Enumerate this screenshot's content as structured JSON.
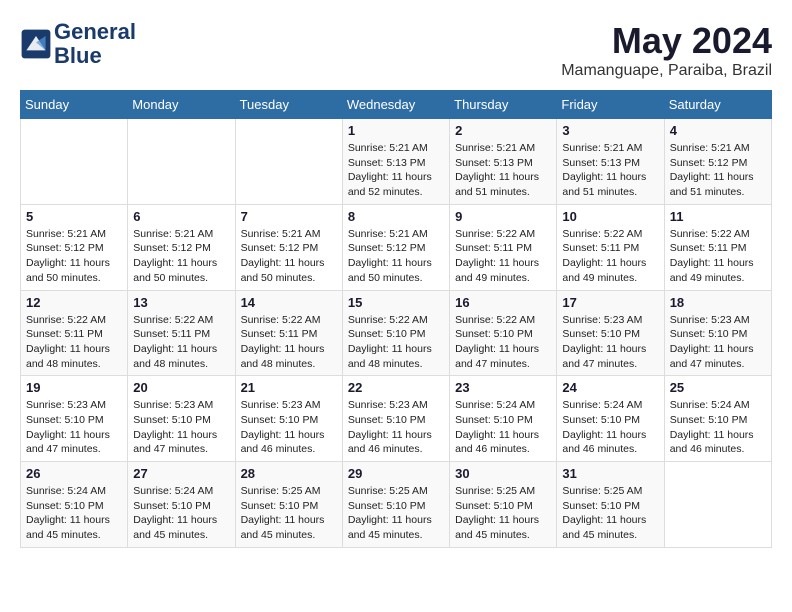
{
  "logo": {
    "line1": "General",
    "line2": "Blue"
  },
  "title": "May 2024",
  "subtitle": "Mamanguape, Paraiba, Brazil",
  "weekdays": [
    "Sunday",
    "Monday",
    "Tuesday",
    "Wednesday",
    "Thursday",
    "Friday",
    "Saturday"
  ],
  "weeks": [
    [
      {
        "day": "",
        "sunrise": "",
        "sunset": "",
        "daylight": ""
      },
      {
        "day": "",
        "sunrise": "",
        "sunset": "",
        "daylight": ""
      },
      {
        "day": "",
        "sunrise": "",
        "sunset": "",
        "daylight": ""
      },
      {
        "day": "1",
        "sunrise": "Sunrise: 5:21 AM",
        "sunset": "Sunset: 5:13 PM",
        "daylight": "Daylight: 11 hours and 52 minutes."
      },
      {
        "day": "2",
        "sunrise": "Sunrise: 5:21 AM",
        "sunset": "Sunset: 5:13 PM",
        "daylight": "Daylight: 11 hours and 51 minutes."
      },
      {
        "day": "3",
        "sunrise": "Sunrise: 5:21 AM",
        "sunset": "Sunset: 5:13 PM",
        "daylight": "Daylight: 11 hours and 51 minutes."
      },
      {
        "day": "4",
        "sunrise": "Sunrise: 5:21 AM",
        "sunset": "Sunset: 5:12 PM",
        "daylight": "Daylight: 11 hours and 51 minutes."
      }
    ],
    [
      {
        "day": "5",
        "sunrise": "Sunrise: 5:21 AM",
        "sunset": "Sunset: 5:12 PM",
        "daylight": "Daylight: 11 hours and 50 minutes."
      },
      {
        "day": "6",
        "sunrise": "Sunrise: 5:21 AM",
        "sunset": "Sunset: 5:12 PM",
        "daylight": "Daylight: 11 hours and 50 minutes."
      },
      {
        "day": "7",
        "sunrise": "Sunrise: 5:21 AM",
        "sunset": "Sunset: 5:12 PM",
        "daylight": "Daylight: 11 hours and 50 minutes."
      },
      {
        "day": "8",
        "sunrise": "Sunrise: 5:21 AM",
        "sunset": "Sunset: 5:12 PM",
        "daylight": "Daylight: 11 hours and 50 minutes."
      },
      {
        "day": "9",
        "sunrise": "Sunrise: 5:22 AM",
        "sunset": "Sunset: 5:11 PM",
        "daylight": "Daylight: 11 hours and 49 minutes."
      },
      {
        "day": "10",
        "sunrise": "Sunrise: 5:22 AM",
        "sunset": "Sunset: 5:11 PM",
        "daylight": "Daylight: 11 hours and 49 minutes."
      },
      {
        "day": "11",
        "sunrise": "Sunrise: 5:22 AM",
        "sunset": "Sunset: 5:11 PM",
        "daylight": "Daylight: 11 hours and 49 minutes."
      }
    ],
    [
      {
        "day": "12",
        "sunrise": "Sunrise: 5:22 AM",
        "sunset": "Sunset: 5:11 PM",
        "daylight": "Daylight: 11 hours and 48 minutes."
      },
      {
        "day": "13",
        "sunrise": "Sunrise: 5:22 AM",
        "sunset": "Sunset: 5:11 PM",
        "daylight": "Daylight: 11 hours and 48 minutes."
      },
      {
        "day": "14",
        "sunrise": "Sunrise: 5:22 AM",
        "sunset": "Sunset: 5:11 PM",
        "daylight": "Daylight: 11 hours and 48 minutes."
      },
      {
        "day": "15",
        "sunrise": "Sunrise: 5:22 AM",
        "sunset": "Sunset: 5:10 PM",
        "daylight": "Daylight: 11 hours and 48 minutes."
      },
      {
        "day": "16",
        "sunrise": "Sunrise: 5:22 AM",
        "sunset": "Sunset: 5:10 PM",
        "daylight": "Daylight: 11 hours and 47 minutes."
      },
      {
        "day": "17",
        "sunrise": "Sunrise: 5:23 AM",
        "sunset": "Sunset: 5:10 PM",
        "daylight": "Daylight: 11 hours and 47 minutes."
      },
      {
        "day": "18",
        "sunrise": "Sunrise: 5:23 AM",
        "sunset": "Sunset: 5:10 PM",
        "daylight": "Daylight: 11 hours and 47 minutes."
      }
    ],
    [
      {
        "day": "19",
        "sunrise": "Sunrise: 5:23 AM",
        "sunset": "Sunset: 5:10 PM",
        "daylight": "Daylight: 11 hours and 47 minutes."
      },
      {
        "day": "20",
        "sunrise": "Sunrise: 5:23 AM",
        "sunset": "Sunset: 5:10 PM",
        "daylight": "Daylight: 11 hours and 47 minutes."
      },
      {
        "day": "21",
        "sunrise": "Sunrise: 5:23 AM",
        "sunset": "Sunset: 5:10 PM",
        "daylight": "Daylight: 11 hours and 46 minutes."
      },
      {
        "day": "22",
        "sunrise": "Sunrise: 5:23 AM",
        "sunset": "Sunset: 5:10 PM",
        "daylight": "Daylight: 11 hours and 46 minutes."
      },
      {
        "day": "23",
        "sunrise": "Sunrise: 5:24 AM",
        "sunset": "Sunset: 5:10 PM",
        "daylight": "Daylight: 11 hours and 46 minutes."
      },
      {
        "day": "24",
        "sunrise": "Sunrise: 5:24 AM",
        "sunset": "Sunset: 5:10 PM",
        "daylight": "Daylight: 11 hours and 46 minutes."
      },
      {
        "day": "25",
        "sunrise": "Sunrise: 5:24 AM",
        "sunset": "Sunset: 5:10 PM",
        "daylight": "Daylight: 11 hours and 46 minutes."
      }
    ],
    [
      {
        "day": "26",
        "sunrise": "Sunrise: 5:24 AM",
        "sunset": "Sunset: 5:10 PM",
        "daylight": "Daylight: 11 hours and 45 minutes."
      },
      {
        "day": "27",
        "sunrise": "Sunrise: 5:24 AM",
        "sunset": "Sunset: 5:10 PM",
        "daylight": "Daylight: 11 hours and 45 minutes."
      },
      {
        "day": "28",
        "sunrise": "Sunrise: 5:25 AM",
        "sunset": "Sunset: 5:10 PM",
        "daylight": "Daylight: 11 hours and 45 minutes."
      },
      {
        "day": "29",
        "sunrise": "Sunrise: 5:25 AM",
        "sunset": "Sunset: 5:10 PM",
        "daylight": "Daylight: 11 hours and 45 minutes."
      },
      {
        "day": "30",
        "sunrise": "Sunrise: 5:25 AM",
        "sunset": "Sunset: 5:10 PM",
        "daylight": "Daylight: 11 hours and 45 minutes."
      },
      {
        "day": "31",
        "sunrise": "Sunrise: 5:25 AM",
        "sunset": "Sunset: 5:10 PM",
        "daylight": "Daylight: 11 hours and 45 minutes."
      },
      {
        "day": "",
        "sunrise": "",
        "sunset": "",
        "daylight": ""
      }
    ]
  ]
}
